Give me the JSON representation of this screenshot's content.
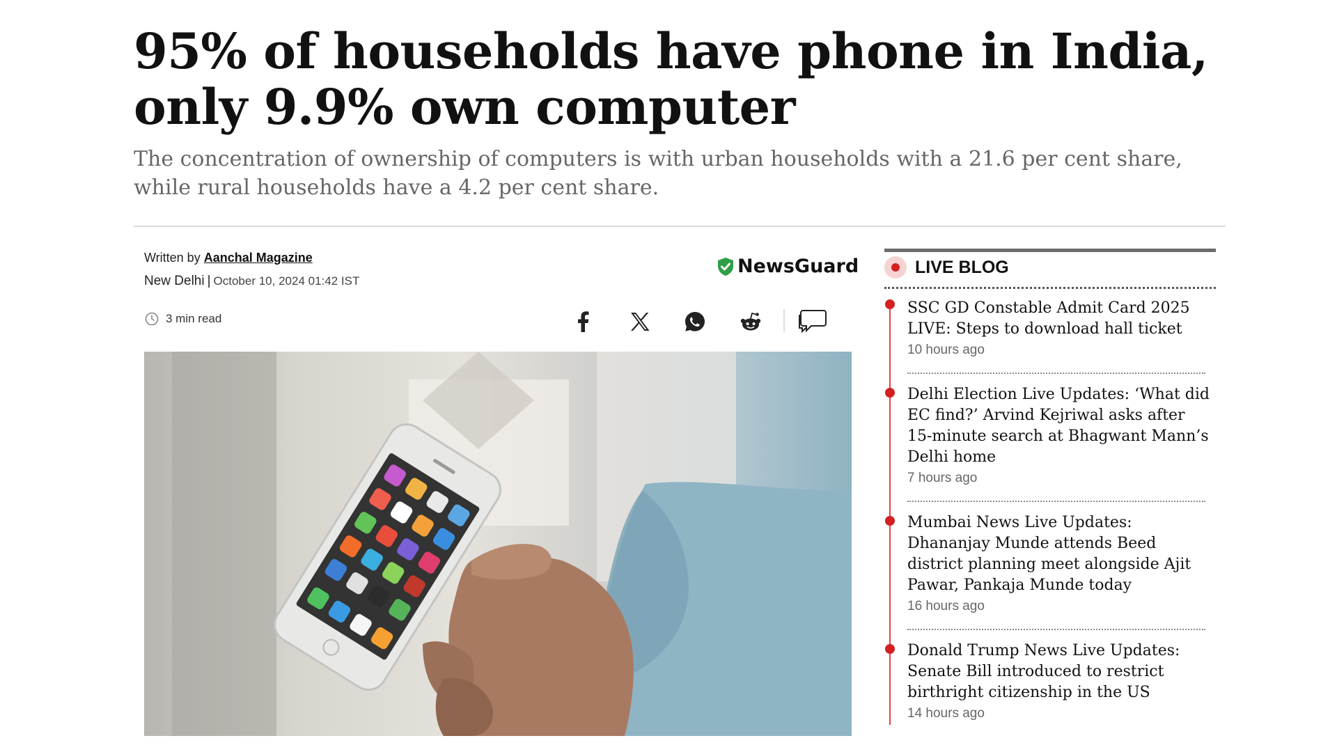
{
  "article": {
    "headline": "95% of households have phone in India, only 9.9% own computer",
    "subheadline": "The concentration of ownership of computers is with urban households with a 21.6 per cent share, while rural households have a 4.2 per cent share.",
    "written_by_label": "Written by",
    "author": "Aanchal Magazine",
    "location": "New Delhi",
    "separator": "|",
    "date": "October 10, 2024 01:42 IST",
    "read_time": "3 min read",
    "newsguard_label": "NewsGuard"
  },
  "share": {
    "icons": [
      "facebook-icon",
      "x-icon",
      "whatsapp-icon",
      "reddit-icon",
      "comments-icon"
    ]
  },
  "live_blog": {
    "title": "LIVE BLOG",
    "items": [
      {
        "title": "SSC GD Constable Admit Card 2025 LIVE: Steps to download hall ticket",
        "time": "10 hours ago"
      },
      {
        "title": "Delhi Election Live Updates: ‘What did EC find?’ Arvind Kejriwal asks after 15-minute search at Bhagwant Mann’s Delhi home",
        "time": "7 hours ago"
      },
      {
        "title": "Mumbai News Live Updates: Dhananjay Munde attends Beed district planning meet alongside Ajit Pawar, Pankaja Munde today",
        "time": "16 hours ago"
      },
      {
        "title": "Donald Trump News Live Updates: Senate Bill introduced to restrict birthright citizenship in the US",
        "time": "14 hours ago"
      }
    ]
  },
  "colors": {
    "live_red": "#d32020",
    "newsguard_green": "#2e9e47"
  }
}
